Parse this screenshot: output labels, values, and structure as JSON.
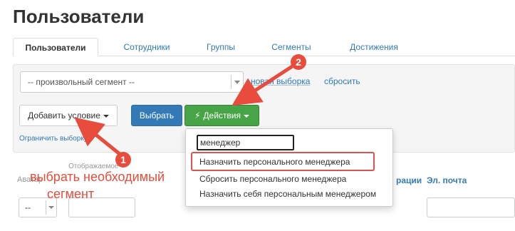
{
  "page": {
    "title": "Пользователи"
  },
  "tabs": [
    {
      "label": "Пользователи",
      "active": true
    },
    {
      "label": "Сотрудники",
      "active": false
    },
    {
      "label": "Группы",
      "active": false
    },
    {
      "label": "Сегменты",
      "active": false
    },
    {
      "label": "Достижения",
      "active": false
    }
  ],
  "filter": {
    "segment_value": "-- произвольный сегмент --",
    "new_selection_link": "новая выборка",
    "reset_link": "сбросить",
    "add_condition_button": "Добавить условие",
    "limit_selection_link": "Ограничить выборку",
    "select_button": "Выбрать",
    "actions_button": "Действия"
  },
  "actions_dropdown": {
    "search_value": "менеджер",
    "items": [
      "Назначить персонального менеджера",
      "Сбросить персонального менеджера",
      "Назначить себя персональным менеджером"
    ]
  },
  "table": {
    "headers": [
      "Аватар",
      "Отображаемое",
      "рации",
      "Эл. почта"
    ],
    "per_page_value": "--"
  },
  "annotations": {
    "badge_1": "1",
    "badge_2": "2",
    "note_line1": "выбрать необходимый",
    "note_line2": "сегмент",
    "color": "#e74c3c"
  },
  "colors": {
    "link": "#337ab7",
    "primary": "#337ab7",
    "success": "#47a447"
  }
}
